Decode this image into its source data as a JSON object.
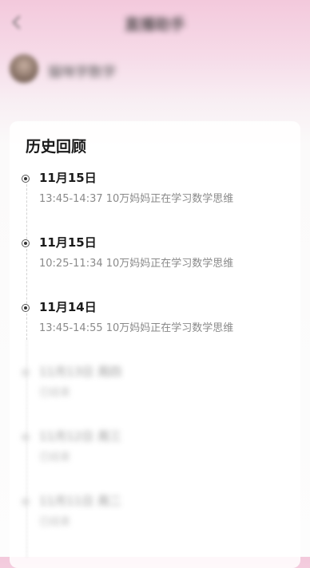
{
  "header": {
    "title": "直播助手"
  },
  "user": {
    "name": "猫咪学数学"
  },
  "history": {
    "title": "历史回顾",
    "items": [
      {
        "date": "11月15日",
        "desc": "13:45-14:37 10万妈妈正在学习数学思维"
      },
      {
        "date": "11月15日",
        "desc": "10:25-11:34 10万妈妈正在学习数学思维"
      },
      {
        "date": "11月14日",
        "desc": "13:45-14:55 10万妈妈正在学习数学思维"
      }
    ],
    "blurred_items": [
      {
        "date": "11月13日 周四",
        "desc": "已结束"
      },
      {
        "date": "11月12日 周三",
        "desc": "已结束"
      },
      {
        "date": "11月11日 周二",
        "desc": "已结束"
      }
    ]
  }
}
